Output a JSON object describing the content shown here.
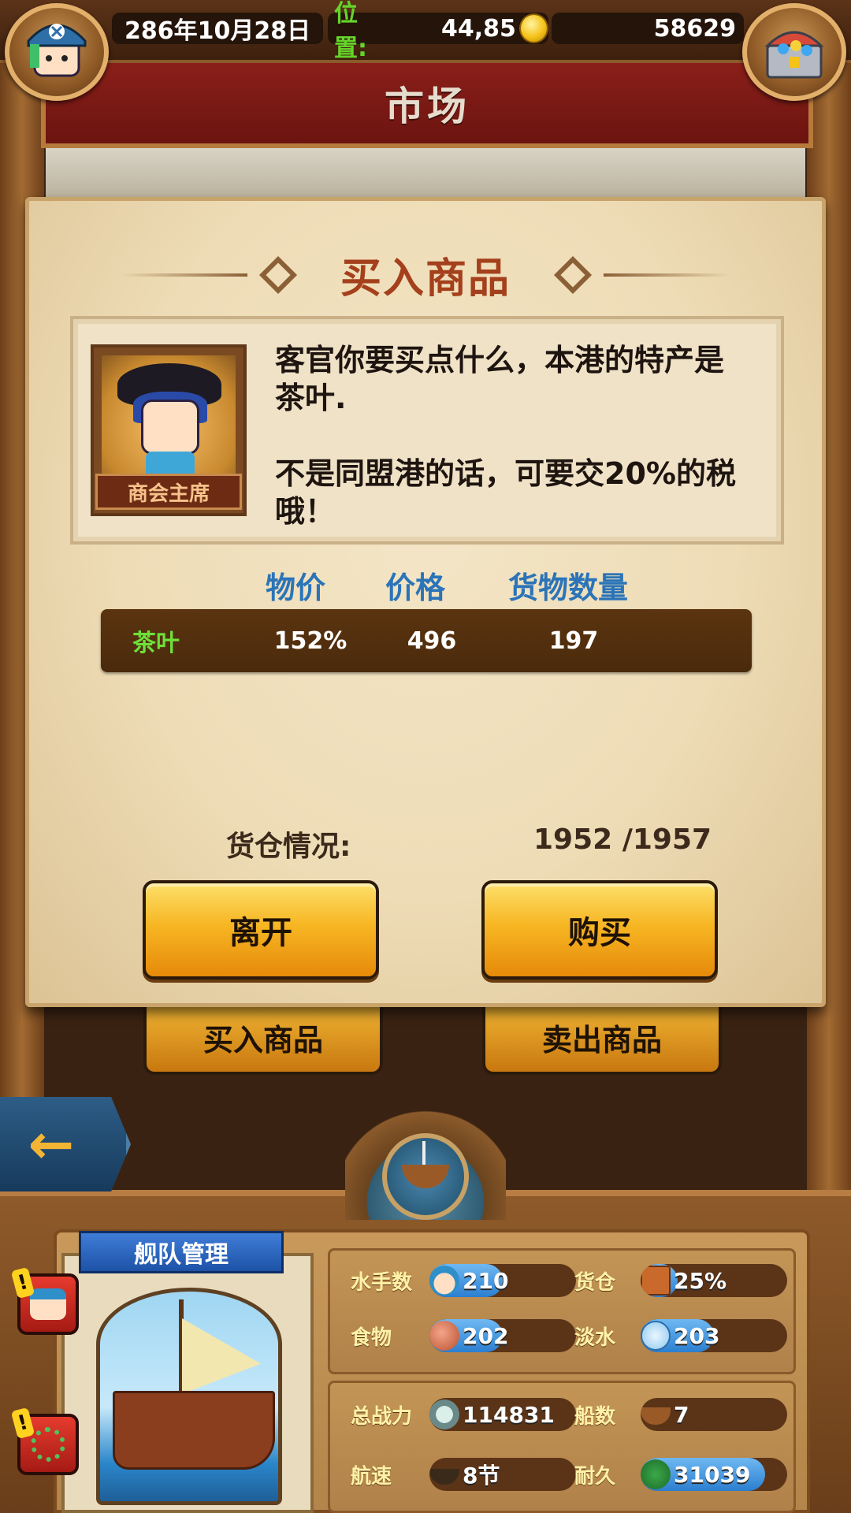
{
  "topbar": {
    "date": "286年10月28日",
    "position_label": "位置:",
    "position_value": "44,85",
    "gold": "58629",
    "left_icon": "captain-avatar-icon",
    "right_icon": "treasure-chest-icon"
  },
  "banner": {
    "title": "市场"
  },
  "dialog": {
    "title": "买入商品",
    "npc": {
      "role_label": "商会主席",
      "line1": "客官你要买点什么，本港的特产是茶叶.",
      "line2": "不是同盟港的话，可要交20%的税哦！"
    },
    "columns": {
      "price_index": "物价",
      "price": "价格",
      "quantity": "货物数量"
    },
    "goods": [
      {
        "name": "茶叶",
        "price_index": "152%",
        "price": "496",
        "quantity": "197"
      }
    ],
    "cargo": {
      "label": "货仓情况:",
      "value": "1952 /1957"
    },
    "buttons": {
      "leave": "离开",
      "buy": "购买"
    }
  },
  "market_buttons": {
    "buy_goods": "买入商品",
    "sell_goods": "卖出商品"
  },
  "back_button": {
    "icon": "back-arrow-icon"
  },
  "fleet": {
    "tag": "舰队管理",
    "stats_top": [
      {
        "label": "水手数",
        "value": "210",
        "icon": "sailor-icon",
        "fill": 0.5
      },
      {
        "label": "货仓",
        "value": "25%",
        "icon": "cargo-crate-icon",
        "fill": 0.25
      },
      {
        "label": "食物",
        "value": "202",
        "icon": "meat-icon",
        "fill": 0.5
      },
      {
        "label": "淡水",
        "value": "203",
        "icon": "water-jug-icon",
        "fill": 0.5
      }
    ],
    "stats_bottom": [
      {
        "label": "总战力",
        "value": "114831",
        "icon": "crossed-swords-icon",
        "fill": 0
      },
      {
        "label": "船数",
        "value": "7",
        "icon": "ship-icon",
        "fill": 0
      },
      {
        "label": "航速",
        "value": "8节",
        "icon": "speed-ship-icon",
        "fill": 0
      },
      {
        "label": "耐久",
        "value": "31039",
        "icon": "durability-icon",
        "fill": 0.85
      }
    ]
  },
  "colors": {
    "banner_red": "#7a1a14",
    "title_brown": "#a4401c",
    "column_blue": "#2b74b8",
    "goods_green": "#6ee03a",
    "button_orange": "#f7b623",
    "stat_blue": "#2b7fd0"
  }
}
